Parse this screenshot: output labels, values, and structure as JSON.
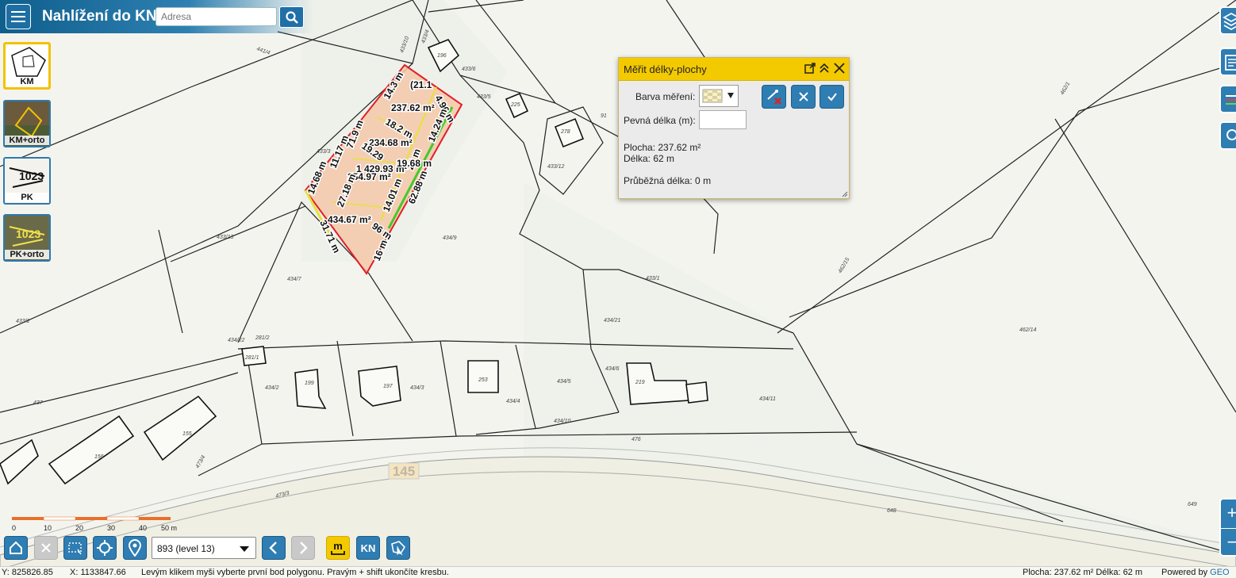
{
  "header": {
    "title": "Nahlížení do KN",
    "search_placeholder": "Adresa"
  },
  "layers": [
    {
      "label": "KM",
      "active": true
    },
    {
      "label": "KM+orto",
      "active": false
    },
    {
      "label": "PK",
      "active": false
    },
    {
      "label": "PK+orto",
      "active": false
    }
  ],
  "measure_dialog": {
    "title": "Měřit délky-plochy",
    "color_label": "Barva měření:",
    "fixed_length_label": "Pevná délka (m):",
    "fixed_length_value": "",
    "area_text": "Plocha: 237.62 m²",
    "length_text": "Délka: 62 m",
    "running_length_text": "Průběžná délka: 0 m"
  },
  "measurements": {
    "areas": [
      "237.62 m²",
      "234.68 m²",
      "1 429.93 m²",
      "254.97 m²",
      "434.67 m²",
      "(21.1"
    ],
    "lengths": [
      "14.3 m",
      "4.96 m",
      "18.2 m",
      "14.24 m",
      "22 m",
      "19.68 m",
      "62.88 m",
      "14.01 m",
      "27.18 m",
      "19.29",
      "11.17 m",
      "71.9 m",
      "14.68 m",
      "31.71 m",
      "96 m",
      "16 m"
    ]
  },
  "map_labels": {
    "parcels": [
      "441/4",
      "433/4",
      "433/10",
      "433/6",
      "433/5",
      "433/3",
      "433/12",
      "433/13",
      "434/2",
      "434/22",
      "281/2",
      "281/1",
      "434/3",
      "434/7",
      "434/6",
      "434/5",
      "434/4",
      "434/10",
      "434/11",
      "434/21",
      "433/1",
      "433/2",
      "437",
      "473/4",
      "473/3",
      "476",
      "462/14",
      "462/15",
      "462/1",
      "649",
      "648",
      "91",
      "434/9"
    ],
    "buildings": [
      "196",
      "225",
      "278",
      "199",
      "197",
      "253",
      "219",
      "155",
      "156"
    ],
    "road_number": "145"
  },
  "scalebar": {
    "ticks": [
      "0",
      "10",
      "20",
      "30",
      "40",
      "50 m"
    ]
  },
  "zoom": {
    "value": "893 (level 13)"
  },
  "toolbar": {
    "kn_label": "KN"
  },
  "status": {
    "y": "Y: 825826.85",
    "x": "X: 1133847.66",
    "hint": "Levým klikem myši vyberte první bod polygonu. Pravým + shift ukončíte kresbu.",
    "summary": "Plocha: 237.62 m² Délka: 62 m",
    "powered_prefix": "Powered by ",
    "powered_brand": "GEO"
  },
  "colors": {
    "header": "#1d6fa5",
    "accent_yellow": "#f3c900",
    "button_blue": "#2e7db3",
    "polygon_fill": "#f5c8a8",
    "polygon_red": "#e0202a",
    "polygon_green": "#45c92a",
    "polygon_yellow": "#e6e23a"
  }
}
